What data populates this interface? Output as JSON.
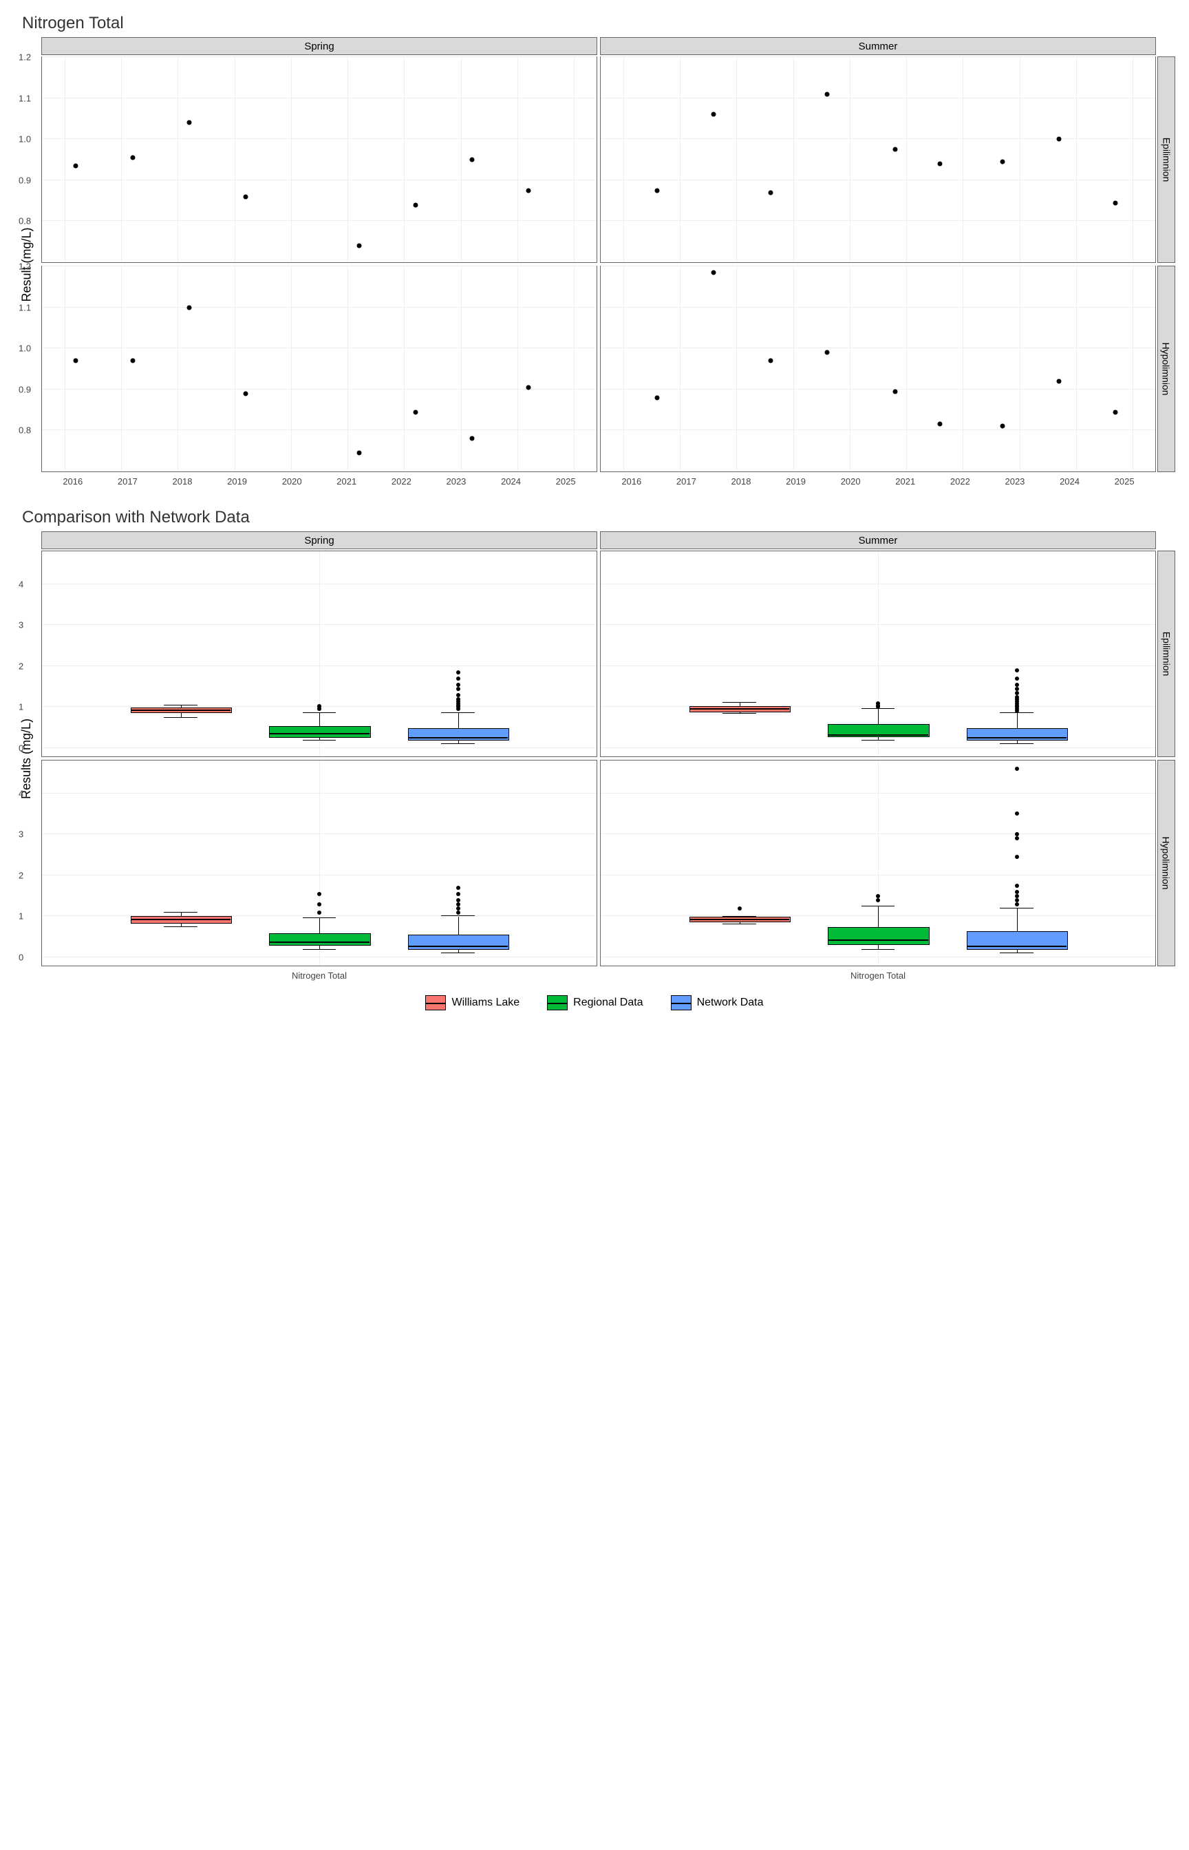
{
  "chart_data": [
    {
      "type": "scatter",
      "title": "Nitrogen Total",
      "xlabel": "",
      "ylabel": "Result (mg/L)",
      "x_ticks": [
        2016,
        2017,
        2018,
        2019,
        2020,
        2021,
        2022,
        2023,
        2024,
        2025
      ],
      "ylim": [
        0.7,
        1.2
      ],
      "y_ticks": [
        0.8,
        0.9,
        1.0,
        1.1,
        1.2
      ],
      "col_facets": [
        "Spring",
        "Summer"
      ],
      "row_facets": [
        "Epilimnion",
        "Hypolimnion"
      ],
      "panels": {
        "Spring_Epilimnion": {
          "x": [
            2016.2,
            2017.2,
            2018.2,
            2019.2,
            2021.2,
            2022.2,
            2023.2,
            2024.2
          ],
          "y": [
            0.935,
            0.955,
            1.04,
            0.86,
            0.74,
            0.84,
            0.95,
            0.875
          ]
        },
        "Summer_Epilimnion": {
          "x": [
            2016.6,
            2017.6,
            2018.6,
            2019.6,
            2020.8,
            2021.6,
            2022.7,
            2023.7,
            2024.7
          ],
          "y": [
            0.875,
            1.06,
            0.87,
            1.11,
            0.975,
            0.94,
            0.945,
            1.0,
            0.845
          ]
        },
        "Spring_Hypolimnion": {
          "x": [
            2016.2,
            2017.2,
            2018.2,
            2019.2,
            2021.2,
            2022.2,
            2023.2,
            2024.2
          ],
          "y": [
            0.97,
            0.97,
            1.1,
            0.89,
            0.745,
            0.845,
            0.78,
            0.905
          ]
        },
        "Summer_Hypolimnion": {
          "x": [
            2016.6,
            2017.6,
            2018.6,
            2019.6,
            2020.8,
            2021.6,
            2022.7,
            2023.7,
            2024.7
          ],
          "y": [
            0.88,
            1.185,
            0.97,
            0.99,
            0.895,
            0.815,
            0.81,
            0.92,
            0.845
          ]
        }
      }
    },
    {
      "type": "boxplot",
      "title": "Comparison with Network Data",
      "xlabel": "Nitrogen Total",
      "ylabel": "Results (mg/L)",
      "ylim": [
        -0.2,
        4.8
      ],
      "y_ticks": [
        0,
        1,
        2,
        3,
        4
      ],
      "col_facets": [
        "Spring",
        "Summer"
      ],
      "row_facets": [
        "Epilimnion",
        "Hypolimnion"
      ],
      "series_colors": {
        "Williams Lake": "#F8766D",
        "Regional Data": "#00BA38",
        "Network Data": "#619CFF"
      },
      "panels": {
        "Spring_Epilimnion": {
          "Williams Lake": {
            "min": 0.74,
            "q1": 0.85,
            "med": 0.9,
            "q3": 0.95,
            "max": 1.04,
            "out": []
          },
          "Regional Data": {
            "min": 0.18,
            "q1": 0.26,
            "med": 0.33,
            "q3": 0.5,
            "max": 0.85,
            "out": [
              0.95,
              1.0,
              1.02
            ]
          },
          "Network Data": {
            "min": 0.1,
            "q1": 0.18,
            "med": 0.23,
            "q3": 0.46,
            "max": 0.85,
            "out": [
              0.95,
              1.0,
              1.05,
              1.1,
              1.15,
              1.2,
              1.3,
              1.45,
              1.55,
              1.7,
              1.85
            ]
          }
        },
        "Summer_Epilimnion": {
          "Williams Lake": {
            "min": 0.845,
            "q1": 0.88,
            "med": 0.94,
            "q3": 1.0,
            "max": 1.11,
            "out": []
          },
          "Regional Data": {
            "min": 0.18,
            "q1": 0.27,
            "med": 0.3,
            "q3": 0.55,
            "max": 0.95,
            "out": [
              1.0,
              1.05,
              1.1
            ]
          },
          "Network Data": {
            "min": 0.1,
            "q1": 0.18,
            "med": 0.24,
            "q3": 0.45,
            "max": 0.85,
            "out": [
              0.9,
              0.95,
              1.0,
              1.05,
              1.1,
              1.15,
              1.2,
              1.25,
              1.35,
              1.45,
              1.55,
              1.7,
              1.9
            ]
          }
        },
        "Spring_Hypolimnion": {
          "Williams Lake": {
            "min": 0.745,
            "q1": 0.83,
            "med": 0.9,
            "q3": 0.97,
            "max": 1.1,
            "out": []
          },
          "Regional Data": {
            "min": 0.18,
            "q1": 0.28,
            "med": 0.35,
            "q3": 0.55,
            "max": 0.95,
            "out": [
              1.1,
              1.3,
              1.55
            ]
          },
          "Network Data": {
            "min": 0.1,
            "q1": 0.18,
            "med": 0.26,
            "q3": 0.52,
            "max": 1.0,
            "out": [
              1.1,
              1.2,
              1.3,
              1.4,
              1.55,
              1.7
            ]
          }
        },
        "Summer_Hypolimnion": {
          "Williams Lake": {
            "min": 0.81,
            "q1": 0.86,
            "med": 0.9,
            "q3": 0.96,
            "max": 0.99,
            "out": [
              1.185
            ]
          },
          "Regional Data": {
            "min": 0.18,
            "q1": 0.3,
            "med": 0.4,
            "q3": 0.7,
            "max": 1.25,
            "out": [
              1.4,
              1.5
            ]
          },
          "Network Data": {
            "min": 0.1,
            "q1": 0.18,
            "med": 0.26,
            "q3": 0.6,
            "max": 1.2,
            "out": [
              1.3,
              1.4,
              1.5,
              1.6,
              1.75,
              2.45,
              2.9,
              3.0,
              3.5,
              4.6
            ]
          }
        }
      }
    }
  ],
  "legend": [
    "Williams Lake",
    "Regional Data",
    "Network Data"
  ]
}
